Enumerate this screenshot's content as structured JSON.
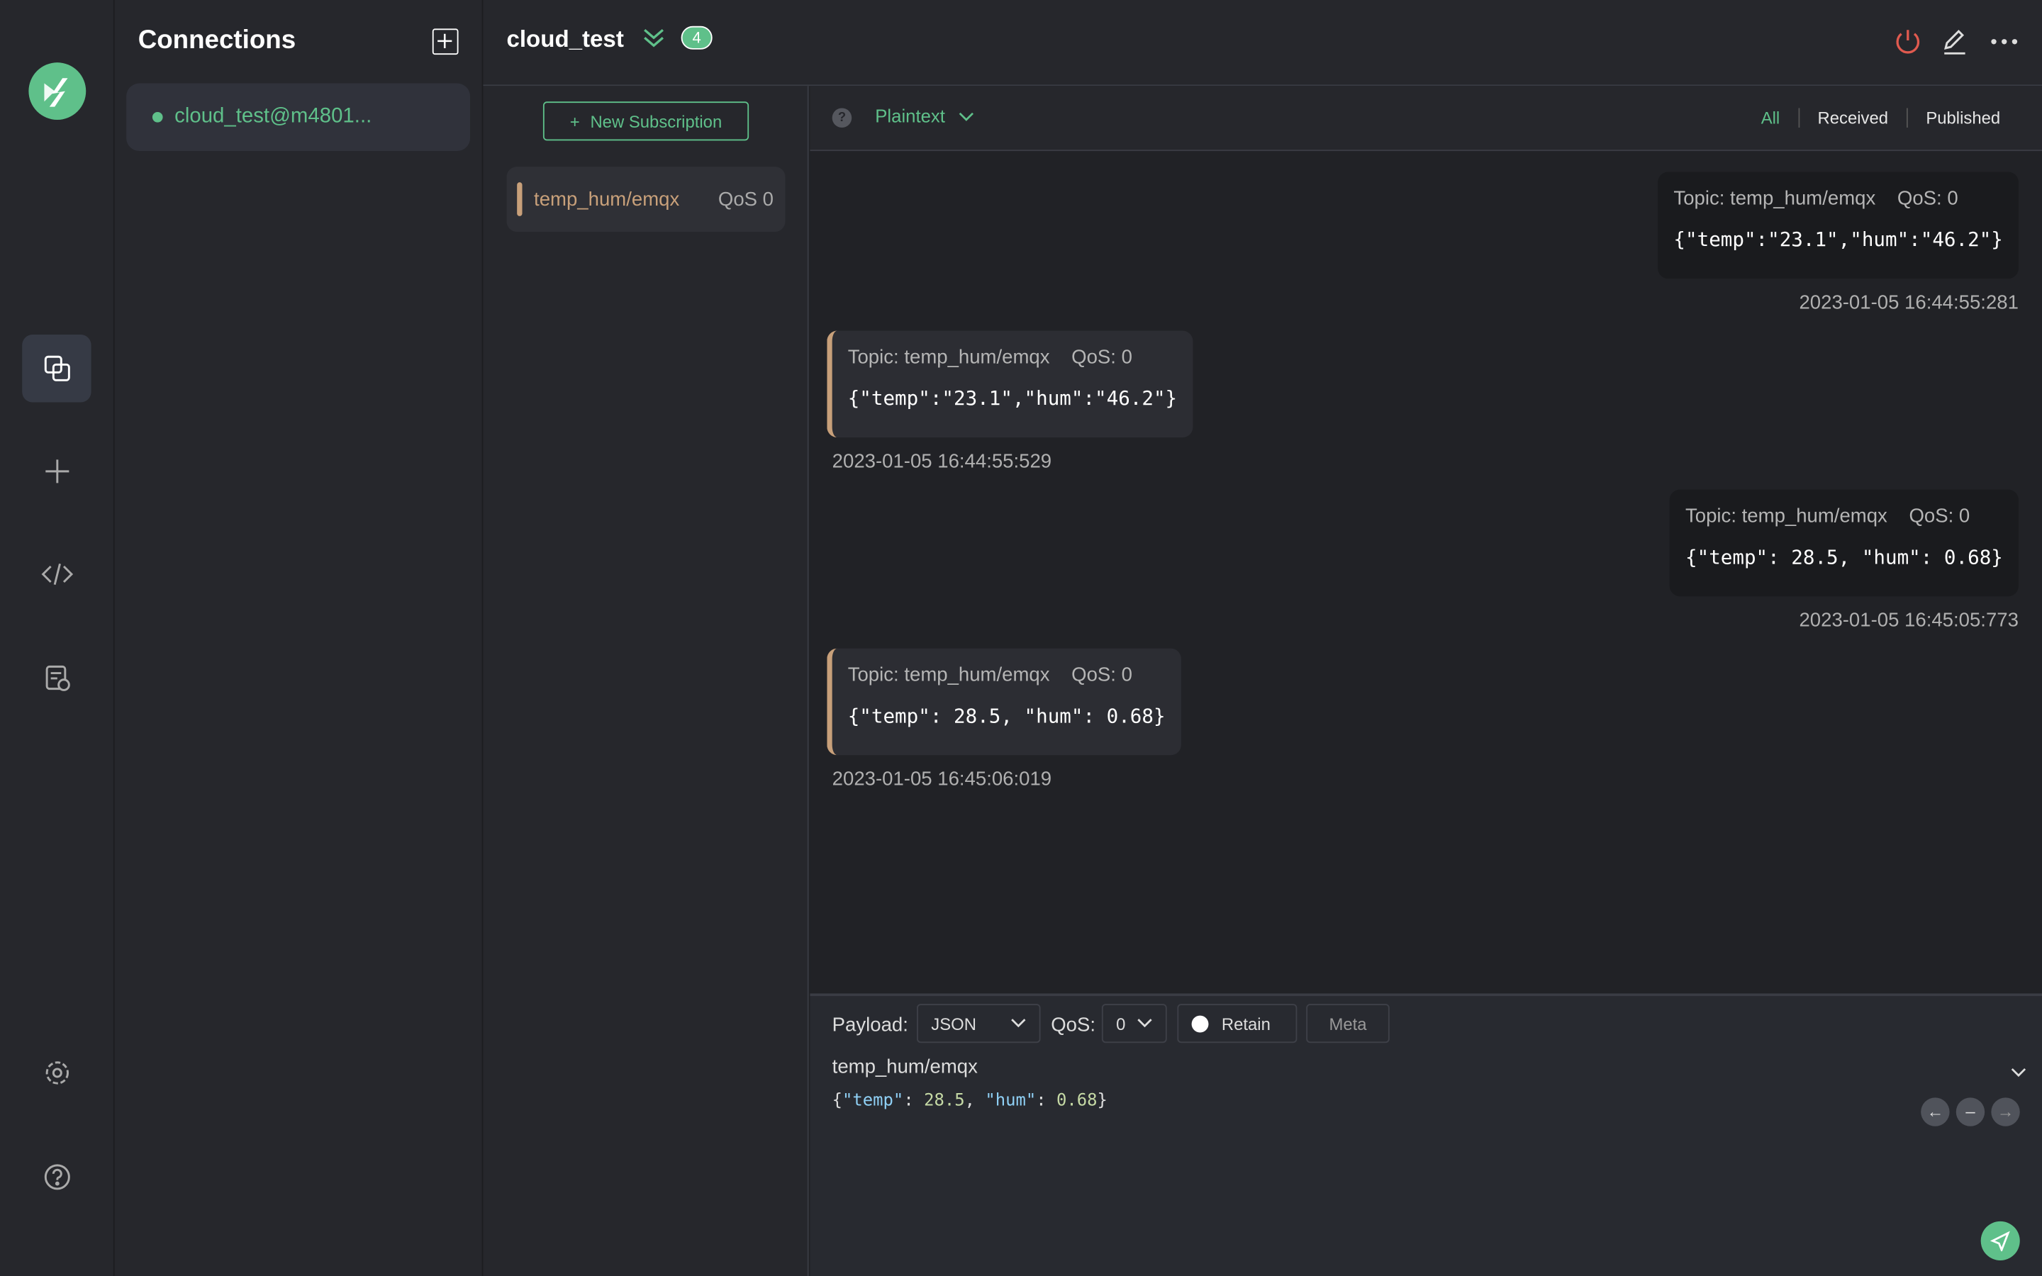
{
  "sidebar": {
    "icons": [
      "connections-icon",
      "new-connection-icon",
      "script-icon",
      "log-icon",
      "settings-icon",
      "help-icon"
    ]
  },
  "connections": {
    "title": "Connections",
    "items": [
      {
        "label": "cloud_test@m4801...",
        "status": "connected"
      }
    ]
  },
  "header": {
    "title": "cloud_test",
    "count": "4"
  },
  "subscriptions": {
    "new_label": "New Subscription",
    "items": [
      {
        "topic": "temp_hum/emqx",
        "qos": "QoS 0",
        "color": "#c8a07a"
      }
    ]
  },
  "messages": {
    "format": "Plaintext",
    "tabs": [
      "All",
      "Received",
      "Published"
    ],
    "list": [
      {
        "type": "published",
        "topic": "Topic: temp_hum/emqx",
        "qos": "QoS: 0",
        "payload": "{\"temp\":\"23.1\",\"hum\":\"46.2\"}",
        "time": "2023-01-05 16:44:55:281"
      },
      {
        "type": "received",
        "topic": "Topic: temp_hum/emqx",
        "qos": "QoS: 0",
        "payload": "{\"temp\":\"23.1\",\"hum\":\"46.2\"}",
        "time": "2023-01-05 16:44:55:529"
      },
      {
        "type": "published",
        "topic": "Topic: temp_hum/emqx",
        "qos": "QoS: 0",
        "payload": "{\"temp\": 28.5, \"hum\": 0.68}",
        "time": "2023-01-05 16:45:05:773"
      },
      {
        "type": "received",
        "topic": "Topic: temp_hum/emqx",
        "qos": "QoS: 0",
        "payload": "{\"temp\": 28.5, \"hum\": 0.68}",
        "time": "2023-01-05 16:45:06:019"
      }
    ]
  },
  "publish": {
    "payload_label": "Payload:",
    "payload_format": "JSON",
    "qos_label": "QoS:",
    "qos": "0",
    "retain": "Retain",
    "meta": "Meta",
    "topic": "temp_hum/emqx",
    "payload_parts": [
      "{",
      "\"temp\"",
      ": ",
      "28.5",
      ", ",
      "\"hum\"",
      ": ",
      "0.68",
      "}"
    ]
  },
  "colors": {
    "accent": "#5fc08a",
    "topic": "#c8a07a",
    "disconnect": "#e05a4f"
  }
}
